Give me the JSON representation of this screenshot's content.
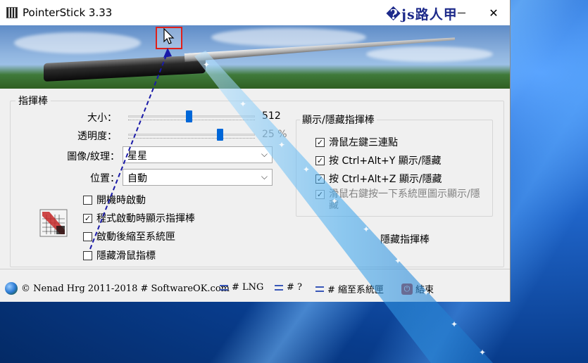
{
  "window": {
    "title": "PointerStick 3.33",
    "watermark": "�js路人甲",
    "minimize": "—",
    "close": "✕"
  },
  "group_stick": {
    "label": "指揮棒",
    "size_label": "大小：",
    "size_value": "512",
    "size_fraction": 0.48,
    "opacity_label": "透明度：",
    "opacity_value": "25 %",
    "opacity_fraction": 0.72,
    "texture_label": "圖像/紋理：",
    "texture_value": "星星",
    "position_label": "位置：",
    "position_value": "自動",
    "checkboxes": [
      {
        "label": "開機時啟動",
        "checked": false
      },
      {
        "label": "程式啟動時顯示指揮棒",
        "checked": true
      },
      {
        "label": "啟動後縮至系統匣",
        "checked": false
      },
      {
        "label": "隱藏滑鼠指標",
        "checked": false
      }
    ],
    "hide_button": "隱藏指揮棒"
  },
  "group_show": {
    "label": "顯示/隱藏指揮棒",
    "checkboxes": [
      {
        "label": "滑鼠左鍵三連點",
        "checked": true
      },
      {
        "label": "按 Ctrl+Alt+Y 顯示/隱藏",
        "checked": true
      },
      {
        "label": "按 Ctrl+Alt+Z 顯示/隱藏",
        "checked": true
      },
      {
        "label": "滑鼠右鍵按一下系統匣圖示顯示/隱藏",
        "checked": true,
        "disabled": true
      }
    ]
  },
  "statusbar": {
    "copyright": "© Nenad Hrg 2011-2018 # SoftwareOK.com",
    "lng": "# LNG",
    "help": "# ?",
    "tray": "# 縮至系統匣",
    "exit": "結束"
  },
  "icons": {
    "app": "pointer-stick-app-icon",
    "cursor": "mouse-cursor-icon",
    "globe": "globe-icon",
    "menu": "lines-icon",
    "power": "power-icon"
  },
  "colors": {
    "accent": "#0067d8",
    "highlight": "#e0201a"
  }
}
